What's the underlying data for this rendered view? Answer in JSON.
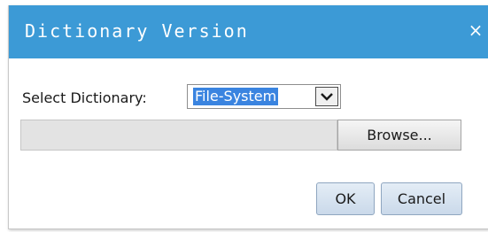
{
  "dialog": {
    "title": "Dictionary Version",
    "close_glyph": "×",
    "select_label": "Select Dictionary:",
    "select_value": "File-System",
    "browse_label": "Browse...",
    "ok_label": "OK",
    "cancel_label": "Cancel"
  },
  "colors": {
    "titlebar": "#3c9ad6",
    "selection": "#3a84e0",
    "button_face": "#cad9ea"
  },
  "icons": {
    "close": "close-icon",
    "dropdown": "chevron-down-icon"
  }
}
